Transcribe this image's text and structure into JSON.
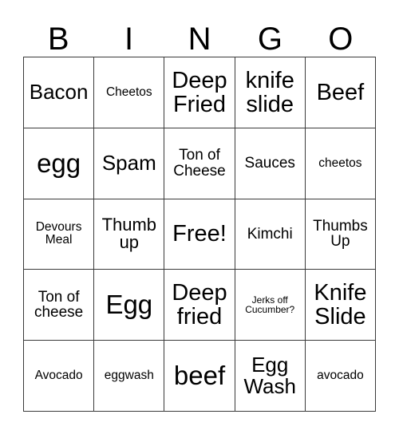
{
  "card": {
    "headers": [
      "B",
      "I",
      "N",
      "G",
      "O"
    ],
    "rows": [
      [
        {
          "text": "Bacon",
          "size": "fs-l"
        },
        {
          "text": "Cheetos",
          "size": "fs-s"
        },
        {
          "text": "Deep Fried",
          "size": "fs-xl"
        },
        {
          "text": "knife slide",
          "size": "fs-xl"
        },
        {
          "text": "Beef",
          "size": "fs-xl"
        }
      ],
      [
        {
          "text": "egg",
          "size": "fs-xxl"
        },
        {
          "text": "Spam",
          "size": "fs-l"
        },
        {
          "text": "Ton of Cheese",
          "size": "fs-m"
        },
        {
          "text": "Sauces",
          "size": "fs-m"
        },
        {
          "text": "cheetos",
          "size": "fs-s"
        }
      ],
      [
        {
          "text": "Devours Meal",
          "size": "fs-s"
        },
        {
          "text": "Thumb up",
          "size": "fs-ml"
        },
        {
          "text": "Free!",
          "size": "fs-xl"
        },
        {
          "text": "Kimchi",
          "size": "fs-m"
        },
        {
          "text": "Thumbs Up",
          "size": "fs-m"
        }
      ],
      [
        {
          "text": "Ton of cheese",
          "size": "fs-m"
        },
        {
          "text": "Egg",
          "size": "fs-xxl"
        },
        {
          "text": "Deep fried",
          "size": "fs-xl"
        },
        {
          "text": "Jerks off Cucumber?",
          "size": "fs-xs"
        },
        {
          "text": "Knife Slide",
          "size": "fs-xl"
        }
      ],
      [
        {
          "text": "Avocado",
          "size": "fs-s"
        },
        {
          "text": "eggwash",
          "size": "fs-s"
        },
        {
          "text": "beef",
          "size": "fs-xxl"
        },
        {
          "text": "Egg Wash",
          "size": "fs-l"
        },
        {
          "text": "avocado",
          "size": "fs-s"
        }
      ]
    ]
  }
}
